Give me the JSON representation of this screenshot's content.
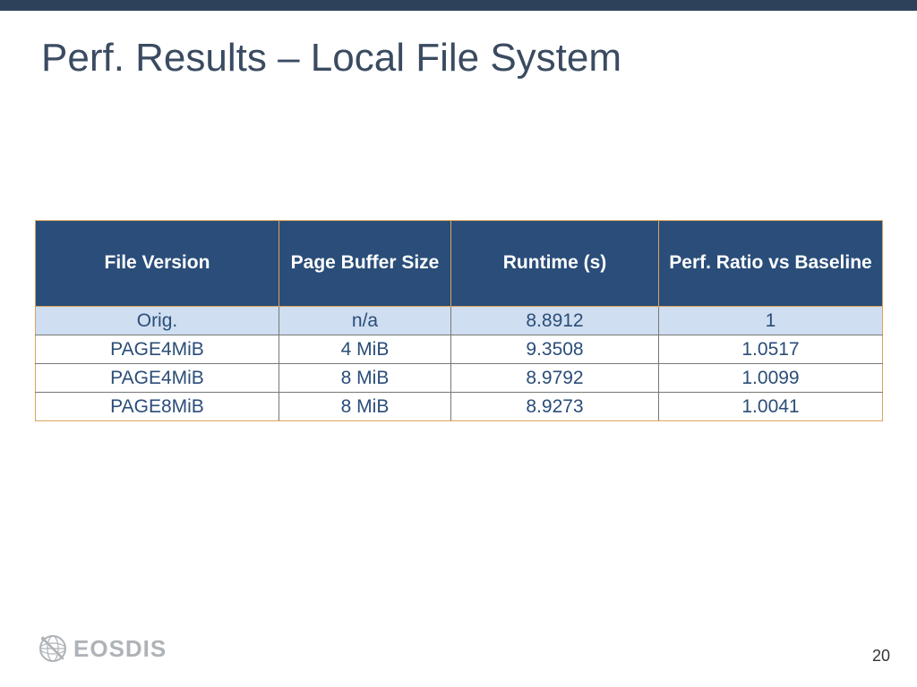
{
  "title": "Perf. Results – Local File System",
  "table": {
    "headers": [
      "File Version",
      "Page Buffer Size",
      "Runtime (s)",
      "Perf. Ratio vs Baseline"
    ],
    "rows": [
      {
        "hl": true,
        "c": [
          "Orig.",
          "n/a",
          "8.8912",
          "1"
        ]
      },
      {
        "hl": false,
        "c": [
          "PAGE4MiB",
          "4 MiB",
          "9.3508",
          "1.0517"
        ]
      },
      {
        "hl": false,
        "c": [
          "PAGE4MiB",
          "8 MiB",
          "8.9792",
          "1.0099"
        ]
      },
      {
        "hl": false,
        "c": [
          "PAGE8MiB",
          "8 MiB",
          "8.9273",
          "1.0041"
        ]
      }
    ]
  },
  "brand": "EOSDIS",
  "page_number": "20",
  "chart_data": {
    "type": "table",
    "title": "Perf. Results – Local File System",
    "columns": [
      "File Version",
      "Page Buffer Size",
      "Runtime (s)",
      "Perf. Ratio vs Baseline"
    ],
    "rows": [
      [
        "Orig.",
        "n/a",
        8.8912,
        1
      ],
      [
        "PAGE4MiB",
        "4 MiB",
        9.3508,
        1.0517
      ],
      [
        "PAGE4MiB",
        "8 MiB",
        8.9792,
        1.0099
      ],
      [
        "PAGE8MiB",
        "8 MiB",
        8.9273,
        1.0041
      ]
    ]
  }
}
